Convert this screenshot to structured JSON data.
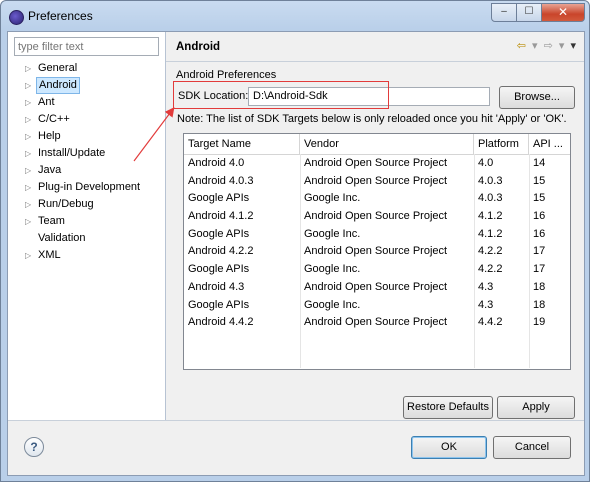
{
  "window": {
    "title": "Preferences",
    "minimize": "–",
    "maximize": "☐",
    "close": "✕"
  },
  "left": {
    "filter_placeholder": "type filter text",
    "tree": [
      {
        "label": "General",
        "arrow": "▷"
      },
      {
        "label": "Android",
        "arrow": "▷",
        "selected": true
      },
      {
        "label": "Ant",
        "arrow": "▷"
      },
      {
        "label": "C/C++",
        "arrow": "▷"
      },
      {
        "label": "Help",
        "arrow": "▷"
      },
      {
        "label": "Install/Update",
        "arrow": "▷"
      },
      {
        "label": "Java",
        "arrow": "▷"
      },
      {
        "label": "Plug-in Development",
        "arrow": "▷"
      },
      {
        "label": "Run/Debug",
        "arrow": "▷"
      },
      {
        "label": "Team",
        "arrow": "▷"
      },
      {
        "label": "Validation",
        "arrow": ""
      },
      {
        "label": "XML",
        "arrow": "▷"
      }
    ]
  },
  "page": {
    "title": "Android",
    "section": "Android Preferences",
    "sdk_label": "SDK Location:",
    "sdk_value": "D:\\Android-Sdk",
    "browse": "Browse...",
    "note": "Note: The list of SDK Targets below is only reloaded once you hit 'Apply' or 'OK'.",
    "nav": {
      "back": "⇦",
      "back_menu": "▾",
      "forward": "⇨",
      "forward_menu": "▾",
      "view_menu": "▾"
    },
    "table": {
      "headers": [
        "Target Name",
        "Vendor",
        "Platform",
        "API ..."
      ],
      "rows": [
        [
          "Android 4.0",
          "Android Open Source Project",
          "4.0",
          "14"
        ],
        [
          "Android 4.0.3",
          "Android Open Source Project",
          "4.0.3",
          "15"
        ],
        [
          "Google APIs",
          "Google Inc.",
          "4.0.3",
          "15"
        ],
        [
          "Android 4.1.2",
          "Android Open Source Project",
          "4.1.2",
          "16"
        ],
        [
          "Google APIs",
          "Google Inc.",
          "4.1.2",
          "16"
        ],
        [
          "Android 4.2.2",
          "Android Open Source Project",
          "4.2.2",
          "17"
        ],
        [
          "Google APIs",
          "Google Inc.",
          "4.2.2",
          "17"
        ],
        [
          "Android 4.3",
          "Android Open Source Project",
          "4.3",
          "18"
        ],
        [
          "Google APIs",
          "Google Inc.",
          "4.3",
          "18"
        ],
        [
          "Android 4.4.2",
          "Android Open Source Project",
          "4.4.2",
          "19"
        ]
      ]
    },
    "restore": "Restore Defaults",
    "apply": "Apply"
  },
  "footer": {
    "help": "?",
    "ok": "OK",
    "cancel": "Cancel"
  },
  "colors": {
    "annotation": "#e23b3b",
    "selection": "#cde8ff"
  }
}
